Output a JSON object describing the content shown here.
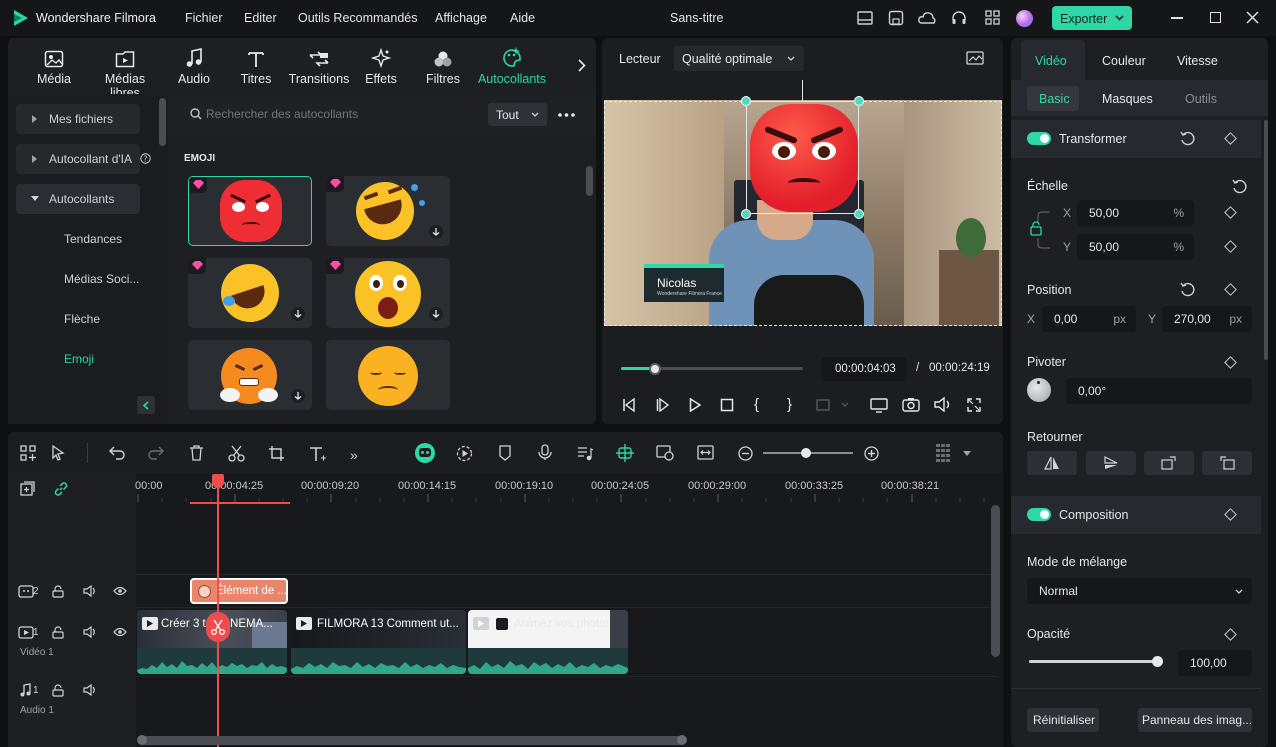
{
  "app": {
    "title": "Wondershare Filmora",
    "project": "Sans-titre",
    "export": "Exporter"
  },
  "menu": [
    "Fichier",
    "Editer",
    "Outils Recommandés",
    "Affichage",
    "Aide"
  ],
  "media_tabs": [
    "Média",
    "Médias libres",
    "Audio",
    "Titres",
    "Transitions",
    "Effets",
    "Filtres",
    "Autocollants"
  ],
  "sidebar": {
    "items": [
      "Mes fichiers",
      "Autocollant d'IA",
      "Autocollants"
    ],
    "sub": [
      "Tendances",
      "Médias Soci...",
      "Flèche",
      "Emoji"
    ]
  },
  "search": {
    "placeholder": "Rechercher des autocollants",
    "filter": "Tout"
  },
  "section": "EMOJI",
  "player": {
    "label": "Lecteur",
    "quality": "Qualité optimale",
    "name": "Nicolas",
    "caption": "Wondershare Filmora France",
    "current": "00:00:04:03",
    "sep": "/",
    "total": "00:00:24:19"
  },
  "ruler": [
    "00:00",
    "00:00:04:25",
    "00:00:09:20",
    "00:00:14:15",
    "00:00:19:10",
    "00:00:24:05",
    "00:00:29:00",
    "00:00:33:25",
    "00:00:38:21"
  ],
  "tracks": {
    "t2": "2",
    "t1": "1",
    "t1name": "Vidéo 1",
    "a1": "1",
    "a1name": "Audio 1"
  },
  "clips": {
    "sticker": "Élément de ...",
    "c1": "Créer 3 t... CINEMA...",
    "c2": "FILMORA 13  Comment ut...",
    "c3": "Animez vos photos"
  },
  "right": {
    "tabs": [
      "Vidéo",
      "Couleur",
      "Vitesse"
    ],
    "subtabs": [
      "Basic",
      "Masques",
      "Outils"
    ],
    "transform": "Transformer",
    "scale": "Échelle",
    "x": "X",
    "y": "Y",
    "scale_x": "50,00",
    "scale_y": "50,00",
    "pct": "%",
    "position": "Position",
    "pos_x": "0,00",
    "pos_y": "270,00",
    "px": "px",
    "rotate": "Pivoter",
    "rot": "0,00°",
    "flip": "Retourner",
    "composition": "Composition",
    "blend_label": "Mode de mélange",
    "blend": "Normal",
    "opacity_label": "Opacité",
    "opacity": "100,00",
    "opacity_level": 1.0,
    "reset": "Réinitialiser",
    "panel": "Panneau des imag..."
  },
  "colors": {
    "accent": "#2fd6a6",
    "emoji": "#ef2f36",
    "clip": "#e9866a"
  }
}
